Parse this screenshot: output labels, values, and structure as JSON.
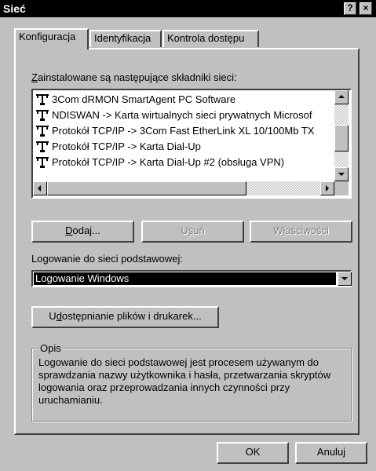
{
  "window": {
    "title": "Sieć"
  },
  "titlebar": {
    "help_label": "?",
    "close_label": "×"
  },
  "tabs": [
    {
      "label": "Konfiguracja",
      "active": true
    },
    {
      "label": "Identyfikacja",
      "active": false
    },
    {
      "label": "Kontrola dostępu",
      "active": false
    }
  ],
  "components": {
    "label_underlined": "Z",
    "label_rest": "ainstalowane są następujące składniki sieci:",
    "items": [
      {
        "label": "3Com dRMON SmartAgent PC Software",
        "icon": "network-component-icon"
      },
      {
        "label": "NDISWAN -> Karta wirtualnych sieci prywatnych Microsof",
        "icon": "network-component-icon"
      },
      {
        "label": "Protokół TCP/IP -> 3Com Fast EtherLink XL 10/100Mb TX",
        "icon": "network-component-icon"
      },
      {
        "label": "Protokół TCP/IP -> Karta Dial-Up",
        "icon": "network-component-icon"
      },
      {
        "label": "Protokół TCP/IP -> Karta Dial-Up #2 (obsługa VPN)",
        "icon": "network-component-icon"
      }
    ]
  },
  "buttons": {
    "add_underlined": "D",
    "add_rest": "odaj...",
    "remove_pre": "U",
    "remove_underlined": "s",
    "remove_rest": "uń",
    "properties_pre": "W",
    "properties_underlined": "ł",
    "properties_rest": "aściwości",
    "sharing_pre": "U",
    "sharing_underlined": "d",
    "sharing_rest": "ostępnianie plików i drukarek...",
    "ok": "OK",
    "cancel": "Anuluj"
  },
  "logon": {
    "label": "Logowanie do sieci podstawowej:",
    "value": "Logowanie Windows"
  },
  "description": {
    "title": "Opis",
    "text": "Logowanie do sieci podstawowej jest procesem używanym do sprawdzania nazwy użytkownika i hasła, przetwarzania skryptów logowania oraz przeprowadzania innych czynności przy uruchamianiu."
  }
}
